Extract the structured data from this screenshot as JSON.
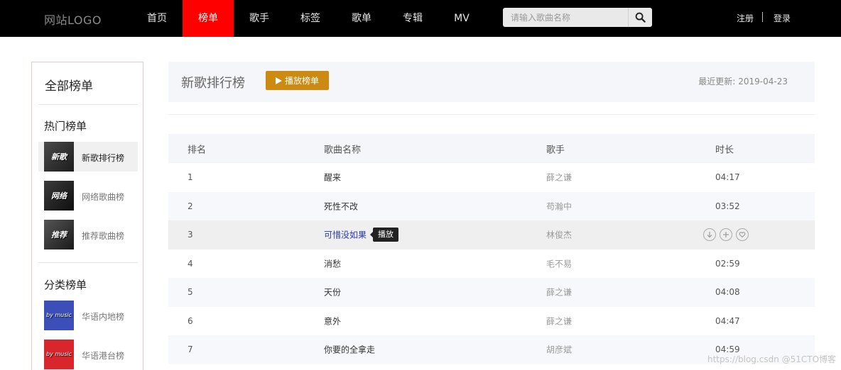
{
  "header": {
    "logo": "网站LOGO",
    "nav": [
      "首页",
      "榜单",
      "歌手",
      "标签",
      "歌单",
      "专辑",
      "MV"
    ],
    "active_nav": "榜单",
    "search_placeholder": "请输入歌曲名称",
    "register": "注册",
    "login": "登录"
  },
  "sidebar": {
    "title": "全部榜单",
    "hot_section": "热门榜单",
    "hot_items": [
      {
        "label": "新歌排行榜",
        "thumb_text": "新歌",
        "active": true
      },
      {
        "label": "网络歌曲榜",
        "thumb_text": "网络",
        "active": false
      },
      {
        "label": "推荐歌曲榜",
        "thumb_text": "推荐",
        "active": false
      }
    ],
    "category_section": "分类榜单",
    "category_items": [
      {
        "label": "华语内地榜",
        "thumb_text": "by music"
      },
      {
        "label": "华语港台榜",
        "thumb_text": "by music"
      }
    ]
  },
  "chart": {
    "title": "新歌排行榜",
    "play_button": "播放榜单",
    "updated_label": "最近更新:",
    "updated_date": "2019-04-23"
  },
  "table": {
    "columns": {
      "rank": "排名",
      "name": "歌曲名称",
      "artist": "歌手",
      "duration": "时长"
    },
    "rows": [
      {
        "rank": "1",
        "name": "醒来",
        "artist": "薛之谦",
        "duration": "04:17"
      },
      {
        "rank": "2",
        "name": "死性不改",
        "artist": "苟瀚中",
        "duration": "03:52"
      },
      {
        "rank": "3",
        "name": "可惜没如果",
        "artist": "林俊杰",
        "duration": ""
      },
      {
        "rank": "4",
        "name": "消愁",
        "artist": "毛不易",
        "duration": "02:59"
      },
      {
        "rank": "5",
        "name": "天份",
        "artist": "薛之谦",
        "duration": "04:08"
      },
      {
        "rank": "6",
        "name": "意外",
        "artist": "薛之谦",
        "duration": "04:47"
      },
      {
        "rank": "7",
        "name": "你要的全拿走",
        "artist": "胡彦斌",
        "duration": "04:59"
      }
    ],
    "hover_tooltip": "播放"
  },
  "watermark": "https://blog.csdn @51CTO博客",
  "colors": {
    "nav_active": "#ff0000",
    "play_button": "#cc8a10",
    "hover_link": "#2c3aa8",
    "topbar": "#000000"
  }
}
